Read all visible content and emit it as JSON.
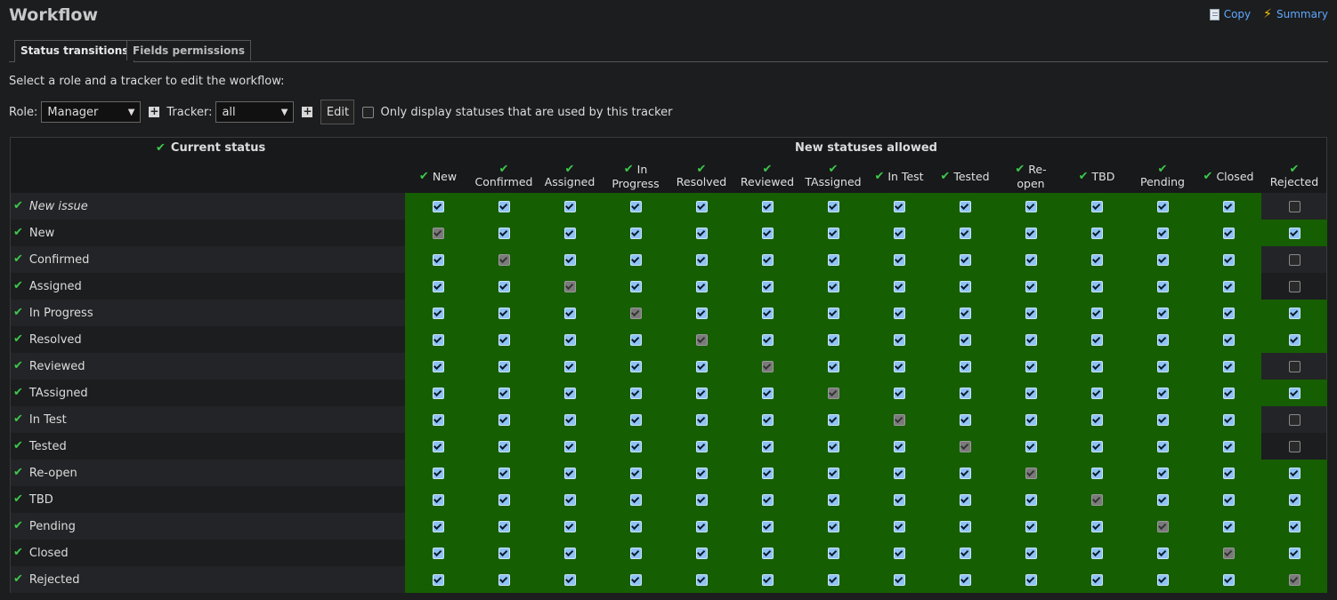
{
  "page": {
    "title": "Workflow"
  },
  "actions": {
    "copy": "Copy",
    "summary": "Summary"
  },
  "tabs": [
    {
      "label": "Status transitions",
      "selected": true
    },
    {
      "label": "Fields permissions",
      "selected": false
    }
  ],
  "instructions": "Select a role and a tracker to edit the workflow:",
  "filters": {
    "role_label": "Role:",
    "role_value": "Manager",
    "tracker_label": "Tracker:",
    "tracker_value": "all",
    "edit_label": "Edit",
    "only_used_label": "Only display statuses that are used by this tracker",
    "only_used_checked": false
  },
  "table": {
    "current_status_header": "Current status",
    "new_statuses_header": "New statuses allowed",
    "columns": [
      {
        "lines": [
          "New"
        ]
      },
      {
        "lines": [
          "",
          "Confirmed"
        ]
      },
      {
        "lines": [
          "",
          "Assigned"
        ]
      },
      {
        "lines": [
          "In",
          "Progress"
        ]
      },
      {
        "lines": [
          "",
          "Resolved"
        ]
      },
      {
        "lines": [
          "",
          "Reviewed"
        ]
      },
      {
        "lines": [
          "",
          "TAssigned"
        ]
      },
      {
        "lines": [
          "In Test"
        ]
      },
      {
        "lines": [
          "Tested"
        ]
      },
      {
        "lines": [
          "Re-",
          "open"
        ]
      },
      {
        "lines": [
          "TBD"
        ]
      },
      {
        "lines": [
          "",
          "Pending"
        ]
      },
      {
        "lines": [
          "Closed"
        ]
      },
      {
        "lines": [
          "",
          "Rejected"
        ]
      }
    ],
    "rows": [
      {
        "label": "New issue",
        "italic": true,
        "rejected": "empty"
      },
      {
        "label": "New",
        "rejected": "checked"
      },
      {
        "label": "Confirmed",
        "rejected": "empty"
      },
      {
        "label": "Assigned",
        "rejected": "empty"
      },
      {
        "label": "In Progress",
        "rejected": "checked"
      },
      {
        "label": "Resolved",
        "rejected": "checked"
      },
      {
        "label": "Reviewed",
        "rejected": "empty"
      },
      {
        "label": "TAssigned",
        "rejected": "checked"
      },
      {
        "label": "In Test",
        "rejected": "empty"
      },
      {
        "label": "Tested",
        "rejected": "empty"
      },
      {
        "label": "Re-open",
        "rejected": "checked"
      },
      {
        "label": "TBD",
        "rejected": "checked"
      },
      {
        "label": "Pending",
        "rejected": "checked"
      },
      {
        "label": "Closed",
        "rejected": "checked"
      },
      {
        "label": "Rejected",
        "rejected": "disabled"
      }
    ],
    "colors": {
      "allowed_bg": "#165e02",
      "checkbox_checked": "#8ec3f5",
      "checkmark_icon": "#3cc94a"
    }
  }
}
